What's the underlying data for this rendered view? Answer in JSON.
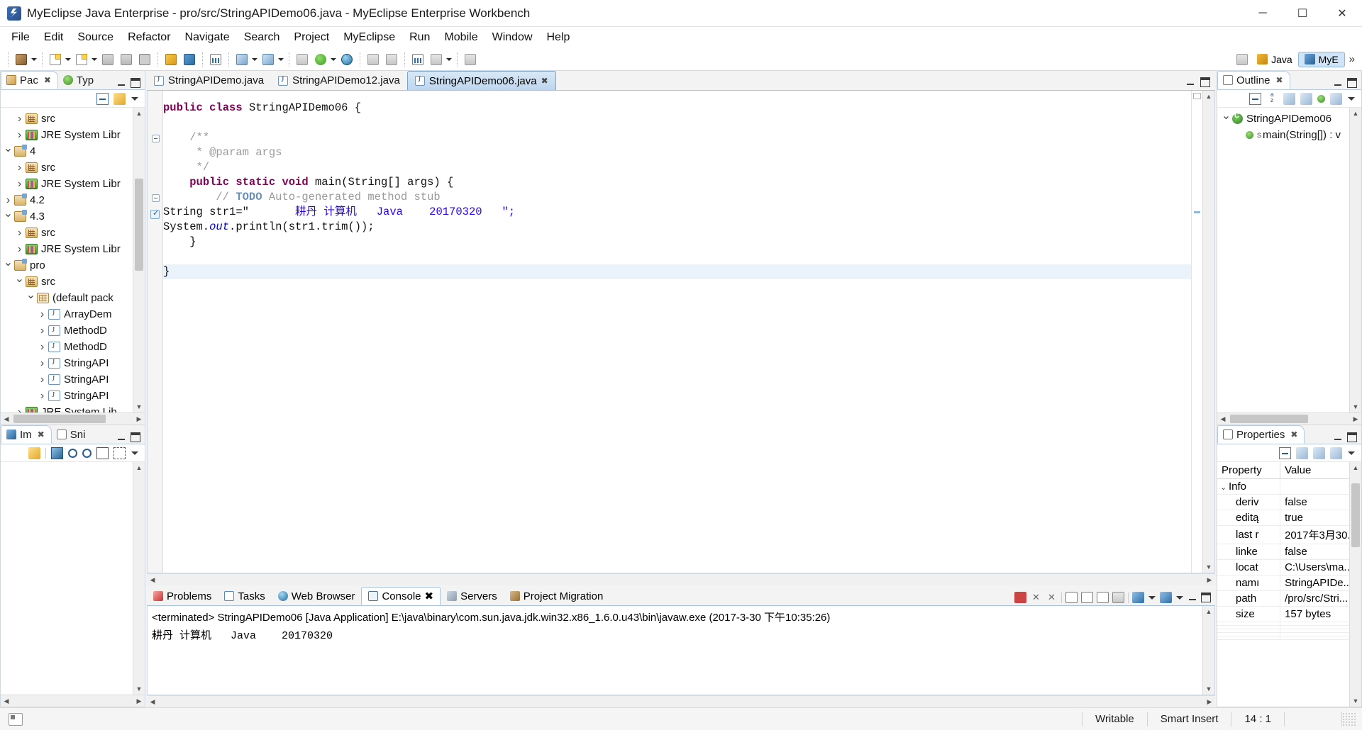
{
  "window": {
    "title": "MyEclipse Java Enterprise - pro/src/StringAPIDemo06.java - MyEclipse Enterprise Workbench",
    "app_icon": "myeclipse-icon",
    "minimize": "─",
    "maximize": "☐",
    "close": "✕"
  },
  "menubar": {
    "items": [
      {
        "label": "File",
        "mnemonic": "F"
      },
      {
        "label": "Edit",
        "mnemonic": "E"
      },
      {
        "label": "Source",
        "mnemonic": "S"
      },
      {
        "label": "Refactor",
        "mnemonic": "t"
      },
      {
        "label": "Navigate",
        "mnemonic": "N"
      },
      {
        "label": "Search",
        "mnemonic": "a"
      },
      {
        "label": "Project",
        "mnemonic": "P"
      },
      {
        "label": "MyEclipse",
        "mnemonic": ""
      },
      {
        "label": "Run",
        "mnemonic": "R"
      },
      {
        "label": "Mobile",
        "mnemonic": ""
      },
      {
        "label": "Window",
        "mnemonic": "W"
      },
      {
        "label": "Help",
        "mnemonic": "H"
      }
    ]
  },
  "toolbar": {
    "icons": [
      "new-wizard-icon",
      "new-file-icon",
      "new-item-icon",
      "save-icon",
      "save-all-icon",
      "print-icon",
      "deploy-icon",
      "deploy-add-icon",
      "web20-icon",
      "debug-icon",
      "run-icon",
      "external-tools-icon",
      "run-as-icon",
      "web-browser-icon",
      "open-type-icon",
      "refresh-icon",
      "chart-icon",
      "task-icon",
      "search-icon"
    ],
    "perspectives": [
      {
        "label": "Java",
        "icon": "java-perspective-icon",
        "active": false
      },
      {
        "label": "MyE",
        "icon": "myeclipse-perspective-icon",
        "active": true
      }
    ],
    "overflow": "»"
  },
  "package_explorer": {
    "tabs": [
      {
        "label": "Pac",
        "icon": "package-explorer-icon",
        "active": true,
        "close": "✖"
      },
      {
        "label": "Typ",
        "icon": "type-hierarchy-icon",
        "active": false
      }
    ],
    "toolbar_icons": [
      "collapse-all-icon",
      "link-with-editor-icon"
    ],
    "minimize": "minimize-icon",
    "maximize": "maximize-icon",
    "tree": [
      {
        "label": "src",
        "icon": "source-folder-icon",
        "indent": 1,
        "twisty": "collapsed"
      },
      {
        "label": "JRE System Libr",
        "icon": "library-icon",
        "indent": 1,
        "twisty": "collapsed"
      },
      {
        "label": "4",
        "icon": "project-icon",
        "indent": 0,
        "twisty": "expanded"
      },
      {
        "label": "src",
        "icon": "source-folder-icon",
        "indent": 1,
        "twisty": "collapsed"
      },
      {
        "label": "JRE System Libr",
        "icon": "library-icon",
        "indent": 1,
        "twisty": "collapsed"
      },
      {
        "label": "4.2",
        "icon": "project-icon",
        "indent": 0,
        "twisty": "collapsed"
      },
      {
        "label": "4.3",
        "icon": "project-icon",
        "indent": 0,
        "twisty": "expanded"
      },
      {
        "label": "src",
        "icon": "source-folder-icon",
        "indent": 1,
        "twisty": "collapsed"
      },
      {
        "label": "JRE System Libr",
        "icon": "library-icon",
        "indent": 1,
        "twisty": "collapsed"
      },
      {
        "label": "pro",
        "icon": "project-icon",
        "indent": 0,
        "twisty": "expanded"
      },
      {
        "label": "src",
        "icon": "source-folder-icon",
        "indent": 1,
        "twisty": "expanded"
      },
      {
        "label": "(default pack",
        "icon": "package-icon",
        "indent": 2,
        "twisty": "expanded"
      },
      {
        "label": "ArrayDem",
        "icon": "java-file-icon",
        "indent": 3,
        "twisty": "collapsed"
      },
      {
        "label": "MethodD",
        "icon": "java-file-icon",
        "indent": 3,
        "twisty": "collapsed"
      },
      {
        "label": "MethodD",
        "icon": "java-file-icon",
        "indent": 3,
        "twisty": "collapsed"
      },
      {
        "label": "StringAPI",
        "icon": "java-file-icon",
        "indent": 3,
        "twisty": "collapsed"
      },
      {
        "label": "StringAPI",
        "icon": "java-file-icon",
        "indent": 3,
        "twisty": "collapsed"
      },
      {
        "label": "StringAPI",
        "icon": "java-file-icon",
        "indent": 3,
        "twisty": "collapsed"
      },
      {
        "label": "JRE System Lib",
        "icon": "library-icon",
        "indent": 1,
        "twisty": "collapsed"
      }
    ]
  },
  "image_view": {
    "tabs": [
      {
        "label": "Im",
        "icon": "image-viewer-icon",
        "active": true,
        "close": "✖"
      },
      {
        "label": "Sni",
        "icon": "snippets-icon",
        "active": false
      }
    ],
    "toolbar_icons": [
      "link-icon",
      "image-icon",
      "zoom-out-icon",
      "zoom-in-icon",
      "actual-size-icon",
      "fit-icon",
      "view-menu-icon"
    ]
  },
  "editor": {
    "tabs": [
      {
        "label": "StringAPIDemo.java",
        "active": false,
        "icon": "java-file-icon"
      },
      {
        "label": "StringAPIDemo12.java",
        "active": false,
        "icon": "java-file-icon"
      },
      {
        "label": "StringAPIDemo06.java",
        "active": true,
        "icon": "java-file-icon",
        "close": "✖"
      }
    ],
    "code_lines": [
      "public class StringAPIDemo06 {",
      "",
      "    /**",
      "     * @param args",
      "     */",
      "    public static void main(String[] args) {",
      "        // TODO Auto-generated method stub",
      "String str1=\"       耕丹 计算机   Java    20170320   \";",
      "System.out.println(str1.trim());",
      "    }",
      "",
      "}"
    ],
    "string_literal_prefix": "String str1=\"",
    "string_literal_body": "耕丹 计算机   Java    20170320",
    "string_literal_suffix": "\";",
    "class_name": "StringAPIDemo06",
    "colors": {
      "keyword": "#7f0055",
      "comment": "#3f7f5f",
      "javadoc": "#9a9a9a",
      "string": "#2a00ff",
      "field": "#0000c0",
      "caret_line": "#eaf2fb"
    }
  },
  "console": {
    "tabs": [
      {
        "label": "Problems",
        "icon": "problems-icon",
        "active": false
      },
      {
        "label": "Tasks",
        "icon": "tasks-icon",
        "active": false
      },
      {
        "label": "Web Browser",
        "icon": "web-browser-icon",
        "active": false
      },
      {
        "label": "Console",
        "icon": "console-icon",
        "active": true,
        "close": "✖"
      },
      {
        "label": "Servers",
        "icon": "servers-icon",
        "active": false
      },
      {
        "label": "Project Migration",
        "icon": "project-migration-icon",
        "active": false
      }
    ],
    "toolbar_icons": [
      "terminate-icon",
      "remove-launch-icon",
      "remove-all-icon",
      "print-icon",
      "open-console-icon",
      "word-wrap-icon",
      "scroll-lock-icon",
      "clear-console-icon",
      "pin-console-icon",
      "display-selected-icon",
      "open-console-menu-icon"
    ],
    "header": "<terminated> StringAPIDemo06 [Java Application] E:\\java\\binary\\com.sun.java.jdk.win32.x86_1.6.0.u43\\bin\\javaw.exe (2017-3-30 下午10:35:26)",
    "output": "耕丹 计算机   Java    20170320"
  },
  "outline": {
    "tabs": [
      {
        "label": "Outline",
        "icon": "outline-icon",
        "active": true,
        "close": "✖"
      }
    ],
    "toolbar_icons": [
      "collapse-all-icon",
      "sort-az-icon",
      "hide-fields-icon",
      "hide-static-icon",
      "hide-nonpublic-icon",
      "hide-local-types-icon",
      "view-menu-icon"
    ],
    "items": [
      {
        "label": "StringAPIDemo06",
        "icon": "class-icon",
        "indent": 0,
        "twisty": "expanded"
      },
      {
        "label": "main(String[]) : v",
        "icon": "method-icon",
        "indent": 1,
        "modifier": "S"
      }
    ]
  },
  "properties": {
    "tabs": [
      {
        "label": "Properties",
        "icon": "properties-icon",
        "active": true,
        "close": "✖"
      }
    ],
    "toolbar_icons": [
      "show-categories-icon",
      "show-advanced-icon",
      "restore-defaults-icon",
      "new-property-icon",
      "view-menu-icon"
    ],
    "columns": [
      "Property",
      "Value"
    ],
    "group": "Info",
    "rows": [
      {
        "key": "deriv",
        "value": "false"
      },
      {
        "key": "editą",
        "value": "true"
      },
      {
        "key": "last r",
        "value": "2017年3月30..."
      },
      {
        "key": "linke",
        "value": "false"
      },
      {
        "key": "locat",
        "value": "C:\\Users\\ma..."
      },
      {
        "key": "namı",
        "value": "StringAPIDe..."
      },
      {
        "key": "path",
        "value": "/pro/src/Stri..."
      },
      {
        "key": "size",
        "value": "157  bytes"
      }
    ]
  },
  "statusbar": {
    "icon": "writable-indicator-icon",
    "cells": [
      "Writable",
      "Smart Insert",
      "14 : 1"
    ]
  }
}
